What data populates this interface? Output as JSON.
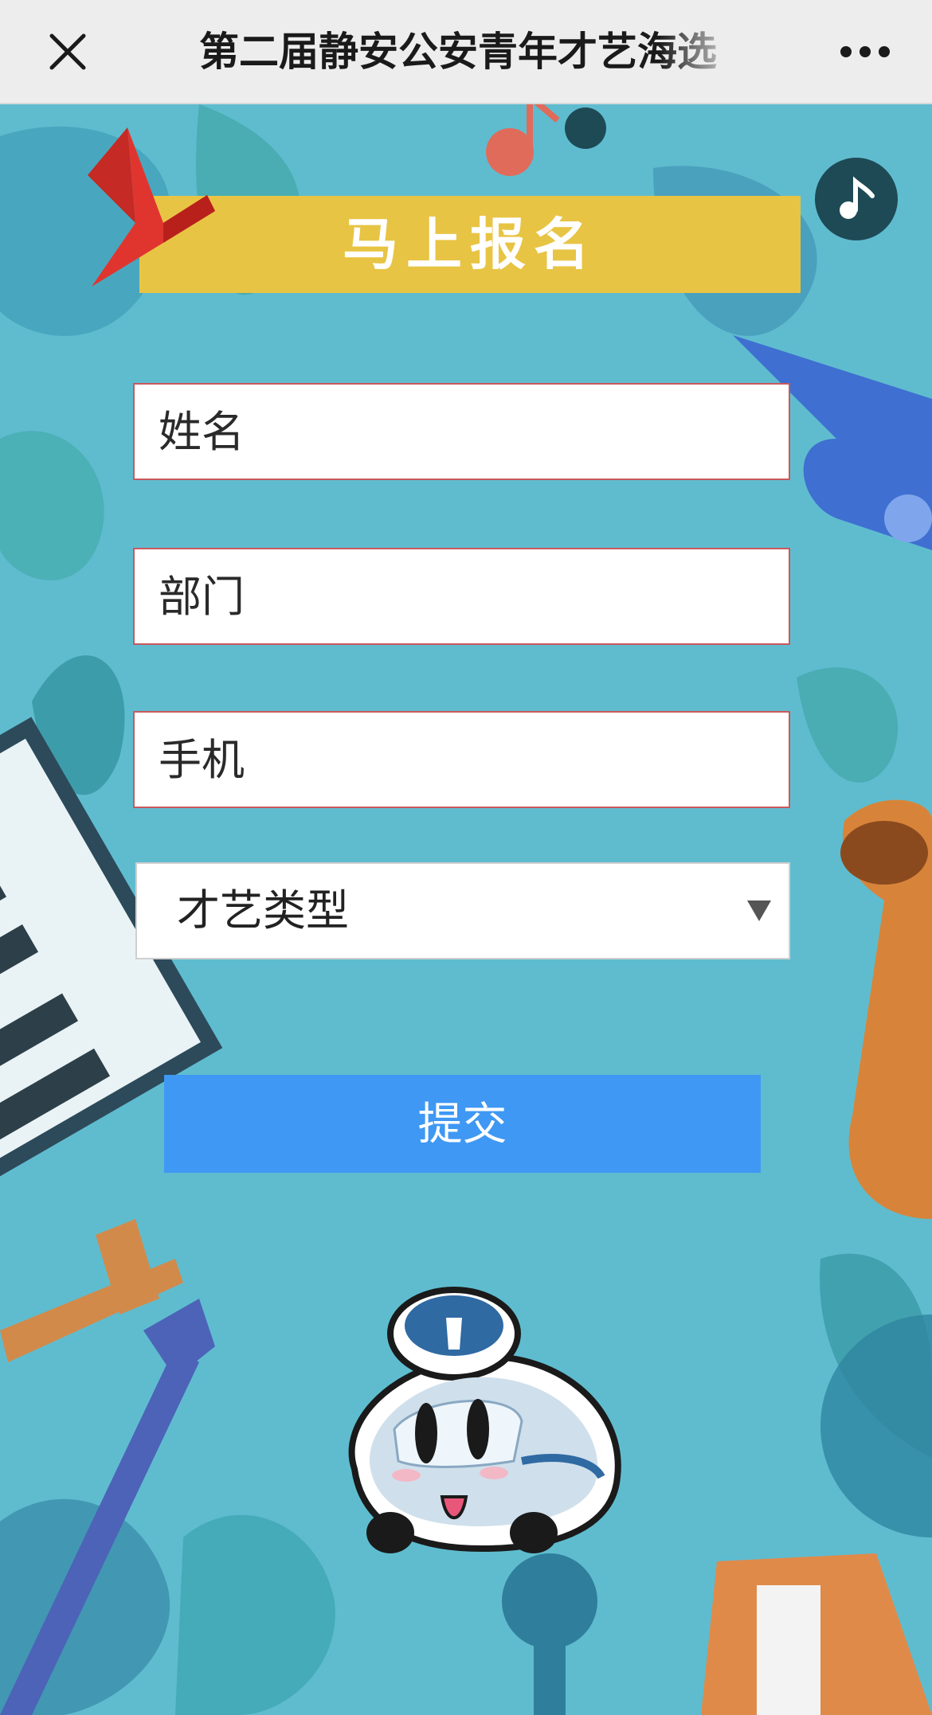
{
  "topbar": {
    "title": "第二届静安公安青年才艺海选",
    "close_icon": "close-icon",
    "more_icon": "more-dots-icon"
  },
  "music": {
    "icon": "music-note-icon"
  },
  "header": {
    "title": "马上报名"
  },
  "form": {
    "name_placeholder": "姓名",
    "department_placeholder": "部门",
    "phone_placeholder": "手机",
    "talent_type_selected": "才艺类型",
    "submit_label": "提交"
  },
  "colors": {
    "background": "#5fbccf",
    "banner": "#e8c444",
    "submit": "#3f98f3",
    "field_border": "#c9585c"
  }
}
